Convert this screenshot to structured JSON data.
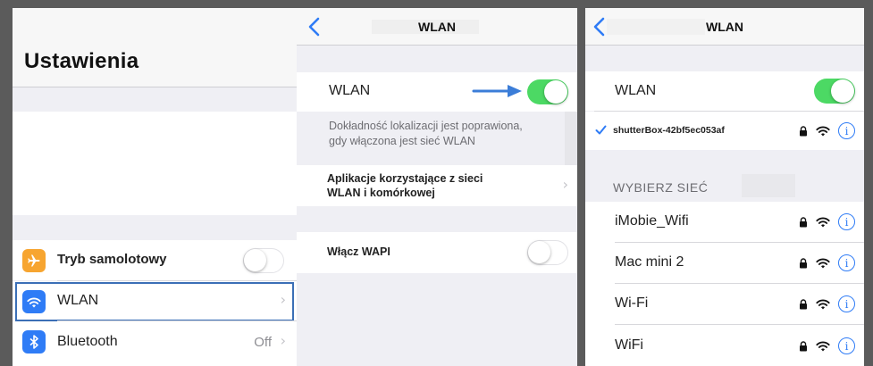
{
  "settings": {
    "title": "Ustawienia",
    "airplane_label": "Tryb samolotowy",
    "wlan_label": "WLAN",
    "bluetooth_label": "Bluetooth",
    "bluetooth_value": "Off",
    "airplane_toggle": "off"
  },
  "wlan_settings": {
    "nav_title": "WLAN",
    "wlan_label": "WLAN",
    "wlan_toggle": "on",
    "footnote_line1": "Dokładność lokalizacji jest poprawiona,",
    "footnote_line2": "gdy włączona jest sieć WLAN",
    "apps_line1": "Aplikacje korzystające z sieci",
    "apps_line2": "WLAN i komórkowej",
    "wapi_label": "Włącz WAPI",
    "wapi_toggle": "off"
  },
  "wlan_networks": {
    "nav_title": "WLAN",
    "wlan_label": "WLAN",
    "wlan_toggle": "on",
    "connected_network": "shutterBox-42bf5ec053af",
    "section_header": "WYBIERZ SIEĆ",
    "networks": [
      {
        "name": "iMobie_Wifi"
      },
      {
        "name": "Mac mini 2"
      },
      {
        "name": "Wi-Fi"
      },
      {
        "name": "WiFi"
      }
    ]
  },
  "colors": {
    "accent_blue": "#2f7cf6",
    "toggle_green": "#4cd964",
    "airplane_orange": "#f7a530",
    "wlan_icon_blue": "#2f7cf6",
    "highlight_border": "#3b6fb6"
  },
  "icons": [
    "airplane-icon",
    "wifi-icon",
    "bluetooth-icon",
    "back-chevron-icon",
    "lock-icon",
    "info-icon",
    "checkmark-icon",
    "arrow-icon"
  ]
}
